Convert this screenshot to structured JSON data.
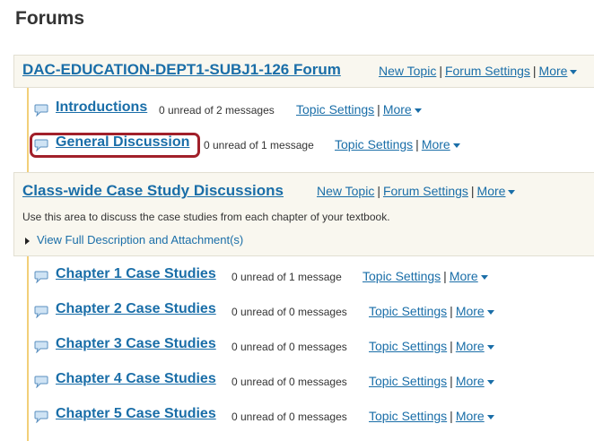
{
  "page": {
    "title": "Forums"
  },
  "forums": [
    {
      "title": "DAC-EDUCATION-DEPT1-SUBJ1-126 Forum",
      "actions": {
        "new_topic": "New Topic",
        "forum_settings": "Forum Settings",
        "more": "More"
      },
      "topics": [
        {
          "name": "Introductions",
          "count": "0 unread of 2 messages",
          "settings": "Topic Settings",
          "more": "More"
        },
        {
          "name": "General Discussion",
          "count": "0 unread of 1 message",
          "settings": "Topic Settings",
          "more": "More",
          "highlighted": true
        }
      ]
    },
    {
      "title": "Class-wide Case Study Discussions",
      "actions": {
        "new_topic": "New Topic",
        "forum_settings": "Forum Settings",
        "more": "More"
      },
      "description": "Use this area to discuss the case studies from each chapter of your textbook.",
      "view_full": "View Full Description and Attachment(s)",
      "topics": [
        {
          "name": "Chapter 1 Case Studies",
          "count": "0 unread of 1 message",
          "settings": "Topic Settings",
          "more": "More"
        },
        {
          "name": "Chapter 2 Case Studies",
          "count": "0 unread of 0 messages",
          "settings": "Topic Settings",
          "more": "More"
        },
        {
          "name": "Chapter 3 Case Studies",
          "count": "0 unread of 0 messages",
          "settings": "Topic Settings",
          "more": "More"
        },
        {
          "name": "Chapter 4 Case Studies",
          "count": "0 unread of 0 messages",
          "settings": "Topic Settings",
          "more": "More"
        },
        {
          "name": "Chapter 5 Case Studies",
          "count": "0 unread of 0 messages",
          "settings": "Topic Settings",
          "more": "More"
        }
      ]
    }
  ],
  "icons": {
    "topic": "speech-bubble-icon",
    "more": "caret-down-icon",
    "expand": "triangle-right-icon"
  },
  "colors": {
    "link": "#1a6ea8",
    "header_bg": "#f9f7ef",
    "rail": "#f2cf79",
    "highlight": "#a1202a"
  }
}
